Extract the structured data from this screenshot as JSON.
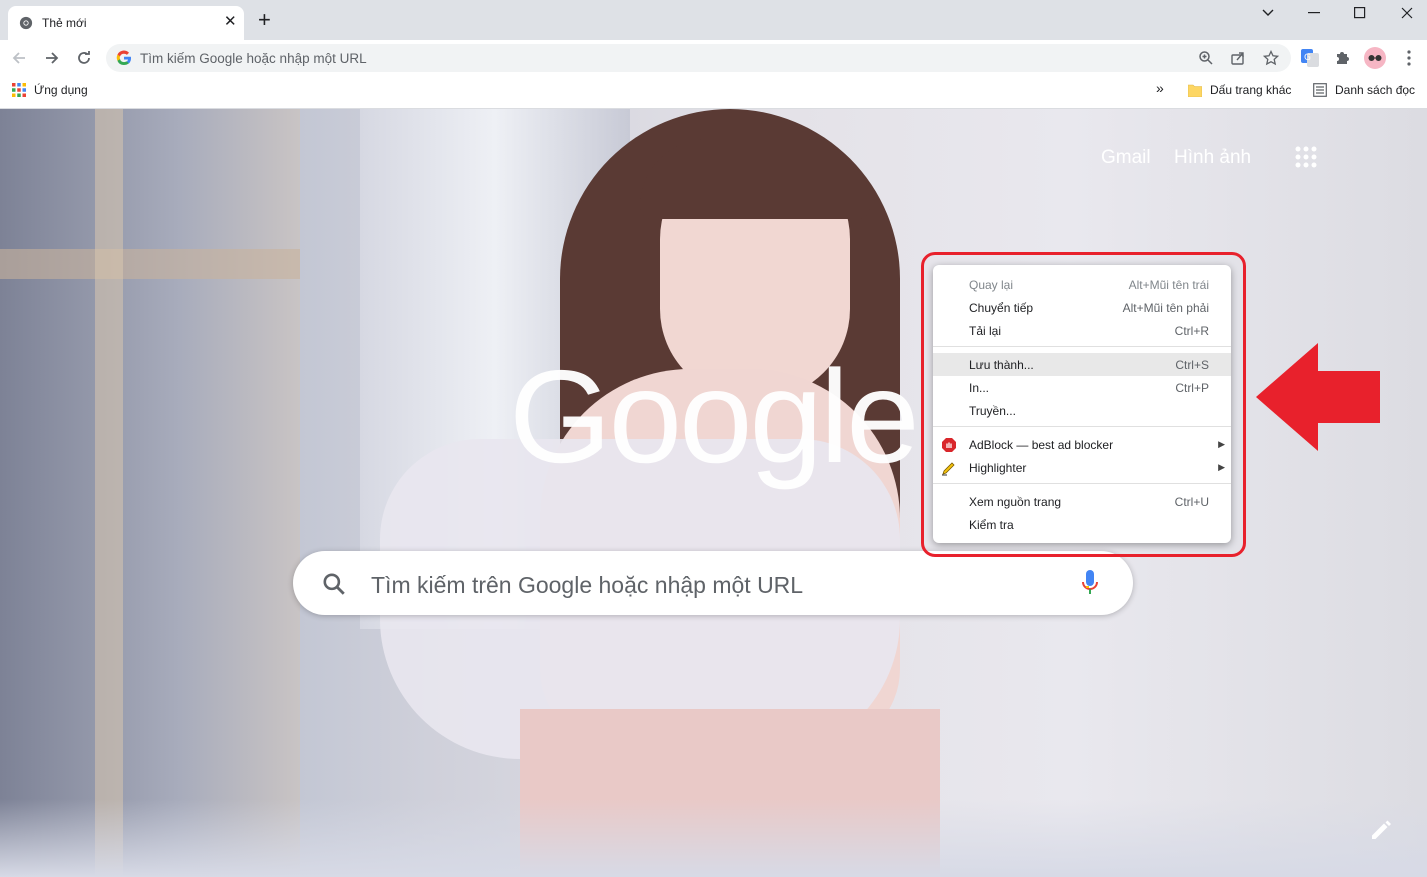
{
  "tab": {
    "title": "Thẻ mới",
    "close": "✕",
    "new_tab": "+"
  },
  "omnibox": {
    "placeholder": "Tìm kiếm Google hoặc nhập một URL"
  },
  "bookmarks": {
    "apps": "Ứng dụng",
    "overflow": "»",
    "other": "Dấu trang khác",
    "reading_list": "Danh sách đọc"
  },
  "ntp": {
    "gmail": "Gmail",
    "images": "Hình ảnh",
    "logo": "Google",
    "search_placeholder": "Tìm kiếm trên Google hoặc nhập một URL"
  },
  "context_menu": {
    "items": [
      {
        "label": "Quay lại",
        "shortcut": "Alt+Mũi tên trái",
        "disabled": true
      },
      {
        "label": "Chuyển tiếp",
        "shortcut": "Alt+Mũi tên phải"
      },
      {
        "label": "Tải lại",
        "shortcut": "Ctrl+R"
      },
      {
        "label": "Lưu thành...",
        "shortcut": "Ctrl+S",
        "highlighted": true
      },
      {
        "label": "In...",
        "shortcut": "Ctrl+P"
      },
      {
        "label": "Truyền..."
      },
      {
        "label": "AdBlock — best ad blocker",
        "submenu": true,
        "icon": "adblock-icon"
      },
      {
        "label": "Highlighter",
        "submenu": true,
        "icon": "highlighter-icon"
      },
      {
        "label": "Xem nguồn trang",
        "shortcut": "Ctrl+U"
      },
      {
        "label": "Kiểm tra"
      }
    ]
  },
  "colors": {
    "annotation_red": "#e8212c",
    "tabstrip": "#dee1e6"
  }
}
